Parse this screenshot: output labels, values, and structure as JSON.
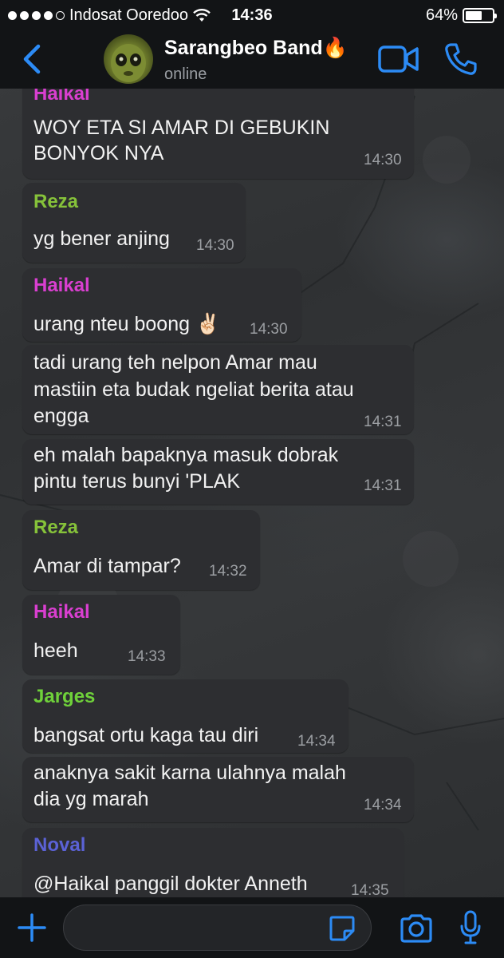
{
  "status_bar": {
    "carrier": "Indosat Ooredoo",
    "time": "14:36",
    "battery_percent": "64%",
    "battery_level": 0.64,
    "signal_dots_filled": 4,
    "signal_dots_total": 5
  },
  "header": {
    "title": "Sarangbeo Band🔥",
    "subtitle": "online",
    "accent_color": "#2c8bf5"
  },
  "messages": [
    {
      "sender": "Haikal",
      "sender_color": "#d93fd0",
      "lines": [
        "WOY ETA SI AMAR DI GEBUKIN",
        "BONYOK NYA"
      ],
      "time": "14:30"
    },
    {
      "sender": "Reza",
      "sender_color": "#86c23a",
      "lines": [
        "yg bener anjing"
      ],
      "time": "14:30"
    },
    {
      "sender": "Haikal",
      "sender_color": "#d93fd0",
      "lines": [
        "urang nteu boong ✌🏻"
      ],
      "time": "14:30"
    },
    {
      "sender": "",
      "lines": [
        "tadi urang teh nelpon Amar mau",
        "mastiin eta budak ngeliat berita atau",
        "engga"
      ],
      "time": "14:31"
    },
    {
      "sender": "",
      "lines": [
        "eh malah bapaknya masuk dobrak",
        "pintu terus bunyi 'PLAK"
      ],
      "time": "14:31"
    },
    {
      "sender": "Reza",
      "sender_color": "#86c23a",
      "lines": [
        "Amar di tampar?"
      ],
      "time": "14:32"
    },
    {
      "sender": "Haikal",
      "sender_color": "#d93fd0",
      "lines": [
        "heeh"
      ],
      "time": "14:33"
    },
    {
      "sender": "Jarges",
      "sender_color": "#6fd13a",
      "lines": [
        "bangsat ortu kaga tau diri"
      ],
      "time": "14:34"
    },
    {
      "sender": "",
      "lines": [
        "anaknya sakit karna ulahnya malah",
        "dia yg marah"
      ],
      "time": "14:34"
    },
    {
      "sender": "Noval",
      "sender_color": "#5b62d6",
      "lines": [
        "@Haikal panggil dokter Anneth"
      ],
      "time": "14:35"
    }
  ],
  "icons": {
    "back": "chevron-left-icon",
    "video": "video-camera-icon",
    "call": "phone-icon",
    "plus": "plus-icon",
    "sticker": "sticker-icon",
    "camera": "camera-icon",
    "mic": "microphone-icon"
  }
}
